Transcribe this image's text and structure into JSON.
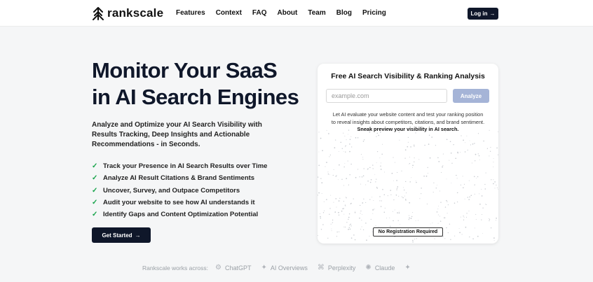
{
  "brand": {
    "name": "rankscale",
    "icon": "rankscale-logo-icon"
  },
  "nav": {
    "links": [
      "Features",
      "Context",
      "FAQ",
      "About",
      "Team",
      "Blog",
      "Pricing"
    ],
    "login_label": "Log in",
    "login_icon": "arrow-right-icon"
  },
  "hero": {
    "title_line1": "Monitor Your SaaS",
    "title_line2": "in AI Search Engines",
    "subtitle": "Analyze and Optimize your AI Search Visibility with Results Tracking, Deep Insights and Actionable Recommendations - in Seconds.",
    "features": [
      "Track your Presence in AI Search Results over Time",
      "Analyze AI Result Citations & Brand Sentiments",
      "Uncover, Survey, and Outpace Competitors",
      "Audit your website to see how AI understands it",
      "Identify Gaps and Content Optimization Potential"
    ],
    "cta_label": "Get Started",
    "check_color": "#16a34a"
  },
  "analysis_card": {
    "title": "Free AI Search Visibility & Ranking Analysis",
    "input_placeholder": "example.com",
    "input_value": "",
    "button_label": "Analyze",
    "description": "Let AI evaluate your website content and test your ranking position to reveal insights about competitors, citations, and brand sentiment.",
    "description_bold": "Sneak preview your visibility in AI search.",
    "badge": "No Registration Required"
  },
  "works_across": {
    "label": "Rankscale works across:",
    "platforms": [
      {
        "name": "ChatGPT",
        "icon": "chatgpt-icon"
      },
      {
        "name": "AI Overviews",
        "icon": "sparkle-icon"
      },
      {
        "name": "Perplexity",
        "icon": "perplexity-icon"
      },
      {
        "name": "Claude",
        "icon": "claude-icon"
      },
      {
        "name": "",
        "icon": "gemini-icon"
      }
    ]
  },
  "colors": {
    "dark": "#0f172a",
    "analyze": "#a5b4d7",
    "page_bg": "#f5f6f7"
  }
}
